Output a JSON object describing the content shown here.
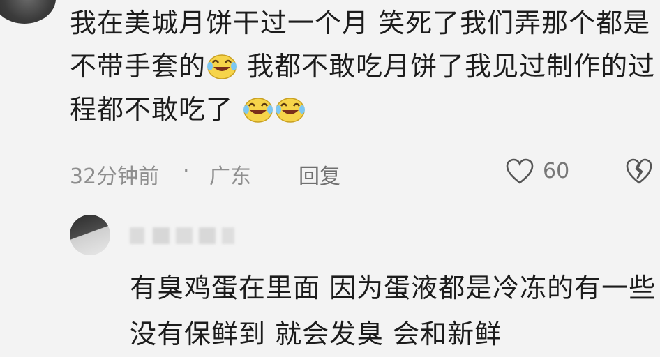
{
  "comment": {
    "text_parts": [
      "我在美城月饼干过一个月  笑死了我们弄那个都是不带手套的",
      "我都不敢吃月饼了我见过制作的过程都不敢吃了 "
    ],
    "emoji_names": [
      "laugh-cry-emoji",
      "laugh-cry-emoji",
      "laugh-cry-emoji"
    ],
    "time": "32分钟前",
    "separator": "·",
    "location": "广东",
    "reply_label": "回复",
    "like_count": "60"
  },
  "reply": {
    "text": "有臭鸡蛋在里面 因为蛋液都是冷冻的有一些没有保鲜到 就会发臭 会和新鲜"
  },
  "colors": {
    "background": "#f3f3f3",
    "text": "#1c1c1c",
    "meta": "#8e8e8e",
    "emoji": "#f6d44a"
  }
}
